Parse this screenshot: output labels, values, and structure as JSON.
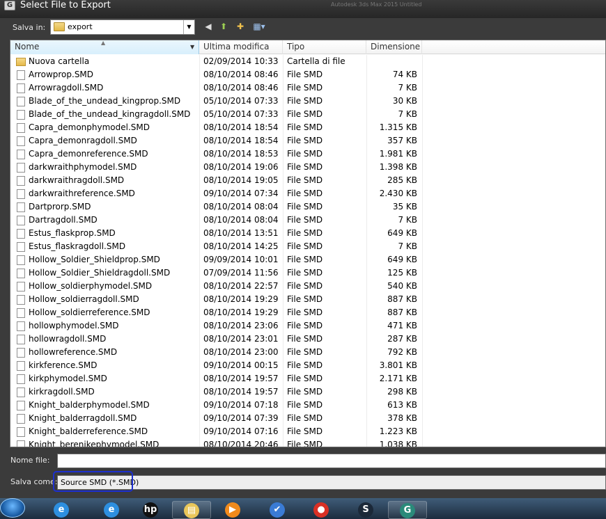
{
  "window": {
    "title": "Select File to Export",
    "background_ghost": "Autodesk 3ds Max 2015   Untitled"
  },
  "toolbar": {
    "save_in_label": "Salva in:",
    "location_value": "export"
  },
  "columns": {
    "name": "Nome",
    "modified": "Ultima modifica",
    "type": "Tipo",
    "size": "Dimensione"
  },
  "files": [
    {
      "name": "Nuova cartella",
      "modified": "02/09/2014 10:33",
      "type": "Cartella di file",
      "size": "",
      "kind": "folder"
    },
    {
      "name": "Arrowprop.SMD",
      "modified": "08/10/2014 08:46",
      "type": "File SMD",
      "size": "74 KB",
      "kind": "file"
    },
    {
      "name": "Arrowragdoll.SMD",
      "modified": "08/10/2014 08:46",
      "type": "File SMD",
      "size": "7 KB",
      "kind": "file"
    },
    {
      "name": "Blade_of_the_undead_kingprop.SMD",
      "modified": "05/10/2014 07:33",
      "type": "File SMD",
      "size": "30 KB",
      "kind": "file"
    },
    {
      "name": "Blade_of_the_undead_kingragdoll.SMD",
      "modified": "05/10/2014 07:33",
      "type": "File SMD",
      "size": "7 KB",
      "kind": "file"
    },
    {
      "name": "Capra_demonphymodel.SMD",
      "modified": "08/10/2014 18:54",
      "type": "File SMD",
      "size": "1.315 KB",
      "kind": "file"
    },
    {
      "name": "Capra_demonragdoll.SMD",
      "modified": "08/10/2014 18:54",
      "type": "File SMD",
      "size": "357 KB",
      "kind": "file"
    },
    {
      "name": "Capra_demonreference.SMD",
      "modified": "08/10/2014 18:53",
      "type": "File SMD",
      "size": "1.981 KB",
      "kind": "file"
    },
    {
      "name": "darkwraithphymodel.SMD",
      "modified": "08/10/2014 19:06",
      "type": "File SMD",
      "size": "1.398 KB",
      "kind": "file"
    },
    {
      "name": "darkwraithragdoll.SMD",
      "modified": "08/10/2014 19:05",
      "type": "File SMD",
      "size": "285 KB",
      "kind": "file"
    },
    {
      "name": "darkwraithreference.SMD",
      "modified": "09/10/2014 07:34",
      "type": "File SMD",
      "size": "2.430 KB",
      "kind": "file"
    },
    {
      "name": "Dartprorp.SMD",
      "modified": "08/10/2014 08:04",
      "type": "File SMD",
      "size": "35 KB",
      "kind": "file"
    },
    {
      "name": "Dartragdoll.SMD",
      "modified": "08/10/2014 08:04",
      "type": "File SMD",
      "size": "7 KB",
      "kind": "file"
    },
    {
      "name": "Estus_flaskprop.SMD",
      "modified": "08/10/2014 13:51",
      "type": "File SMD",
      "size": "649 KB",
      "kind": "file"
    },
    {
      "name": "Estus_flaskragdoll.SMD",
      "modified": "08/10/2014 14:25",
      "type": "File SMD",
      "size": "7 KB",
      "kind": "file"
    },
    {
      "name": "Hollow_Soldier_Shieldprop.SMD",
      "modified": "09/09/2014 10:01",
      "type": "File SMD",
      "size": "649 KB",
      "kind": "file"
    },
    {
      "name": "Hollow_Soldier_Shieldragdoll.SMD",
      "modified": "07/09/2014 11:56",
      "type": "File SMD",
      "size": "125 KB",
      "kind": "file"
    },
    {
      "name": "Hollow_soldierphymodel.SMD",
      "modified": "08/10/2014 22:57",
      "type": "File SMD",
      "size": "540 KB",
      "kind": "file"
    },
    {
      "name": "Hollow_soldierragdoll.SMD",
      "modified": "08/10/2014 19:29",
      "type": "File SMD",
      "size": "887 KB",
      "kind": "file"
    },
    {
      "name": "Hollow_soldierreference.SMD",
      "modified": "08/10/2014 19:29",
      "type": "File SMD",
      "size": "887 KB",
      "kind": "file"
    },
    {
      "name": "hollowphymodel.SMD",
      "modified": "08/10/2014 23:06",
      "type": "File SMD",
      "size": "471 KB",
      "kind": "file"
    },
    {
      "name": "hollowragdoll.SMD",
      "modified": "08/10/2014 23:01",
      "type": "File SMD",
      "size": "287 KB",
      "kind": "file"
    },
    {
      "name": "hollowreference.SMD",
      "modified": "08/10/2014 23:00",
      "type": "File SMD",
      "size": "792 KB",
      "kind": "file"
    },
    {
      "name": "kirkference.SMD",
      "modified": "09/10/2014 00:15",
      "type": "File SMD",
      "size": "3.801 KB",
      "kind": "file"
    },
    {
      "name": "kirkphymodel.SMD",
      "modified": "08/10/2014 19:57",
      "type": "File SMD",
      "size": "2.171 KB",
      "kind": "file"
    },
    {
      "name": "kirkragdoll.SMD",
      "modified": "08/10/2014 19:57",
      "type": "File SMD",
      "size": "298 KB",
      "kind": "file"
    },
    {
      "name": "Knight_balderphymodel.SMD",
      "modified": "09/10/2014 07:18",
      "type": "File SMD",
      "size": "613 KB",
      "kind": "file"
    },
    {
      "name": "Knight_balderragdoll.SMD",
      "modified": "09/10/2014 07:39",
      "type": "File SMD",
      "size": "378 KB",
      "kind": "file"
    },
    {
      "name": "Knight_balderreference.SMD",
      "modified": "09/10/2014 07:16",
      "type": "File SMD",
      "size": "1.223 KB",
      "kind": "file"
    },
    {
      "name": "Knight_berenikephymodel.SMD",
      "modified": "08/10/2014 20:46",
      "type": "File SMD",
      "size": "1.038 KB",
      "kind": "file"
    }
  ],
  "bottom": {
    "filename_label": "Nome file:",
    "filename_value": "",
    "saveas_label": "Salva come:",
    "saveas_value": "Source SMD (*.SMD)"
  },
  "taskbar": {
    "items": [
      {
        "icon": "internet-explorer-icon",
        "glyph": "e",
        "color": "#2d8fe0"
      },
      {
        "icon": "internet-explorer-icon",
        "glyph": "e",
        "color": "#2d8fe0"
      },
      {
        "icon": "hp-icon",
        "glyph": "hp",
        "color": "#111111"
      },
      {
        "icon": "file-explorer-icon",
        "glyph": "▤",
        "color": "#e9c65a"
      },
      {
        "icon": "media-player-icon",
        "glyph": "▶",
        "color": "#f08a1c"
      },
      {
        "icon": "task-check-icon",
        "glyph": "✔",
        "color": "#3a7bd5"
      },
      {
        "icon": "chrome-icon",
        "glyph": "●",
        "color": "#d93025"
      },
      {
        "icon": "steam-icon",
        "glyph": "S",
        "color": "#1b2838"
      },
      {
        "icon": "3ds-max-icon",
        "glyph": "G",
        "color": "#2a8a7a"
      }
    ]
  },
  "colors": {
    "accent": "#1c2fd0",
    "header_selected": "#d8effc",
    "dialog_bg": "#3b3b3b"
  }
}
